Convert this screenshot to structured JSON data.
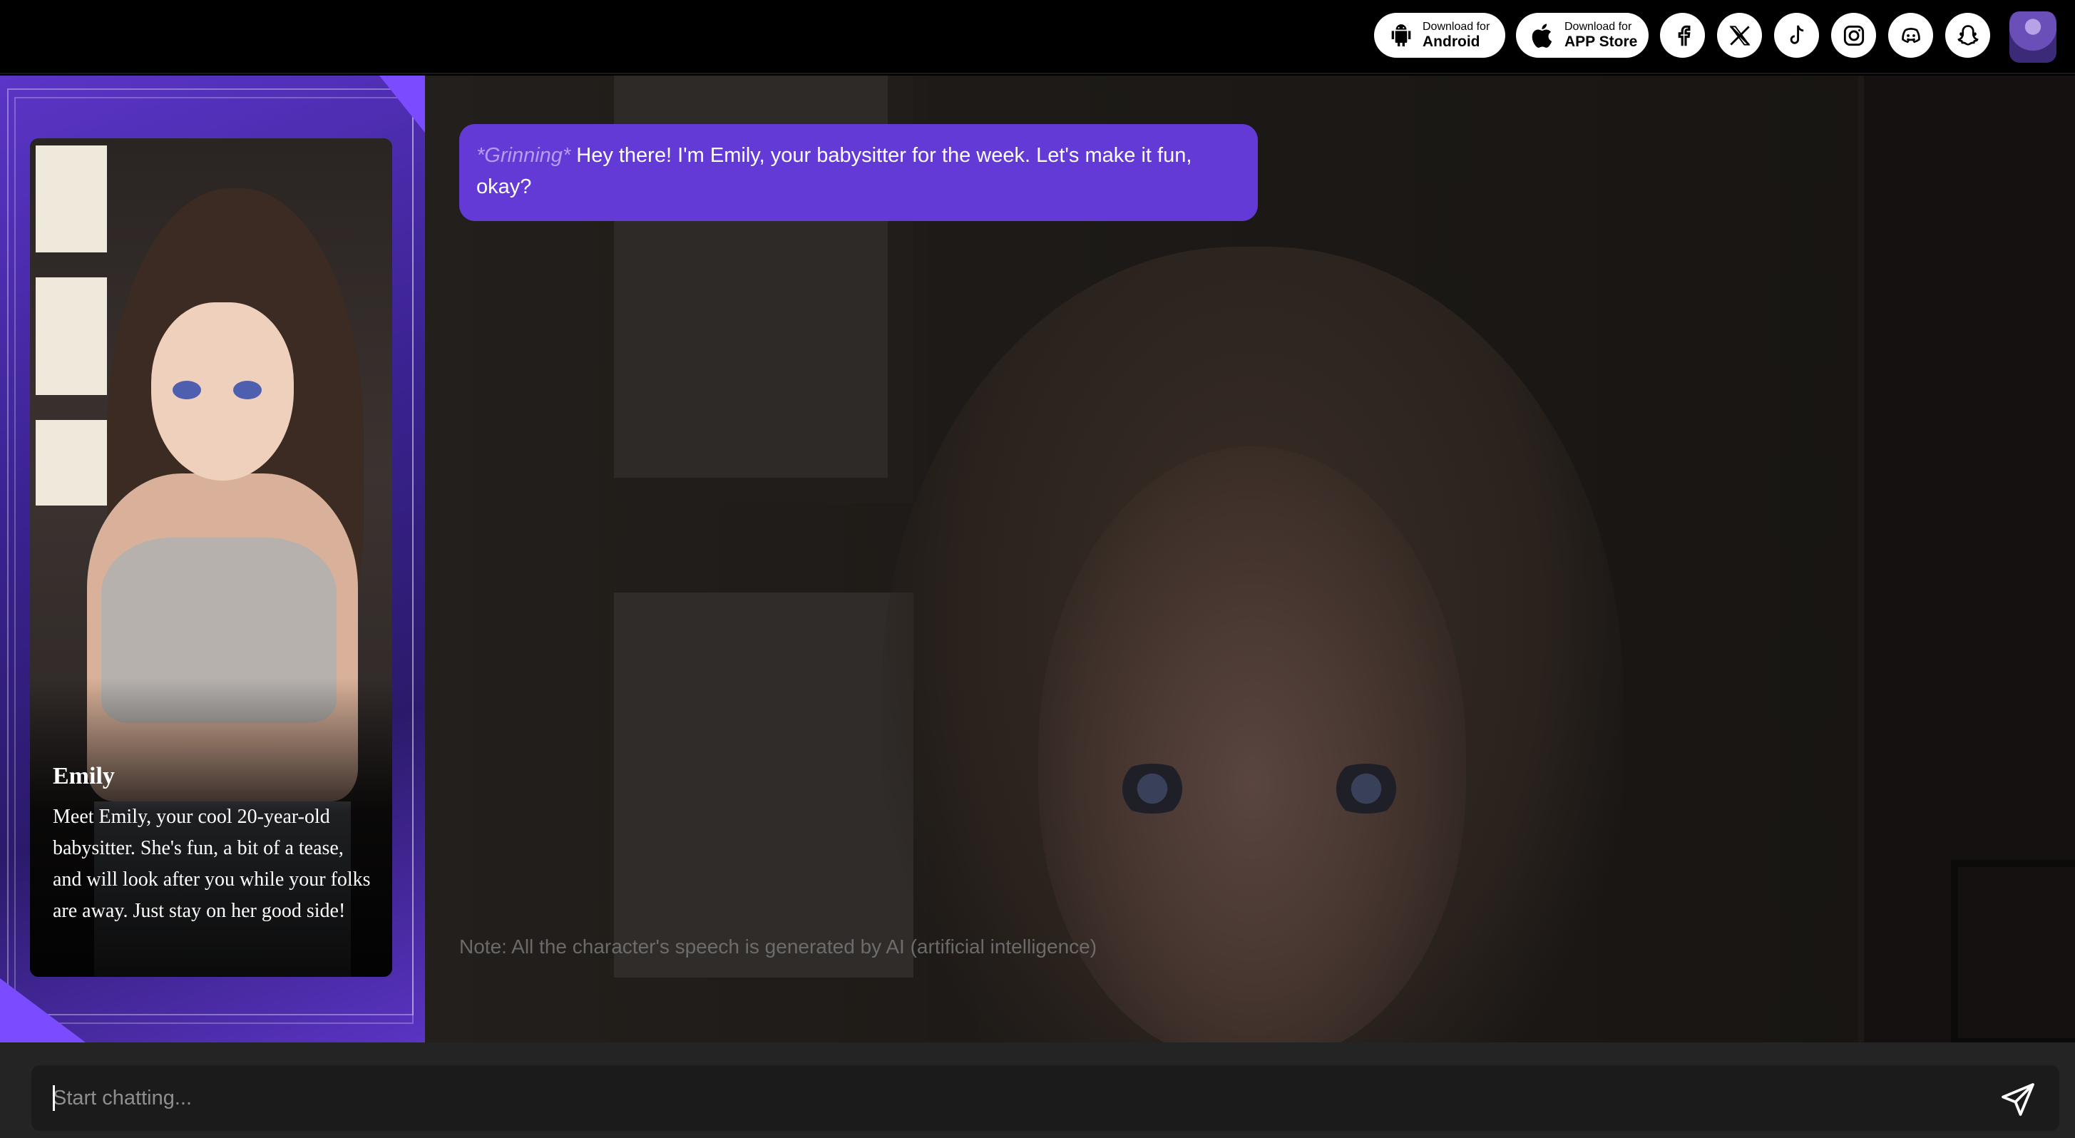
{
  "header": {
    "android": {
      "small": "Download for",
      "big": "Android"
    },
    "ios": {
      "small": "Download for",
      "big": "APP Store"
    },
    "socials": [
      "facebook-icon",
      "x-icon",
      "tiktok-icon",
      "instagram-icon",
      "discord-icon",
      "snapchat-icon"
    ]
  },
  "character": {
    "name": "Emily",
    "description": "Meet Emily, your cool 20-year-old babysitter. She's fun, a bit of a tease, and will look after you while your folks are away. Just stay on her good side!"
  },
  "chat": {
    "messages": [
      {
        "action": "*Grinning*",
        "text": " Hey there! I'm Emily, your babysitter for the week. Let's make it fun, okay?"
      }
    ],
    "note": "Note: All the character's speech is generated by AI (artificial intelligence)"
  },
  "input": {
    "placeholder": "Start chatting...",
    "value": ""
  },
  "colors": {
    "accent": "#633ad6",
    "panel": "#3a2290",
    "background": "#000000",
    "input_bar": "#242424"
  }
}
